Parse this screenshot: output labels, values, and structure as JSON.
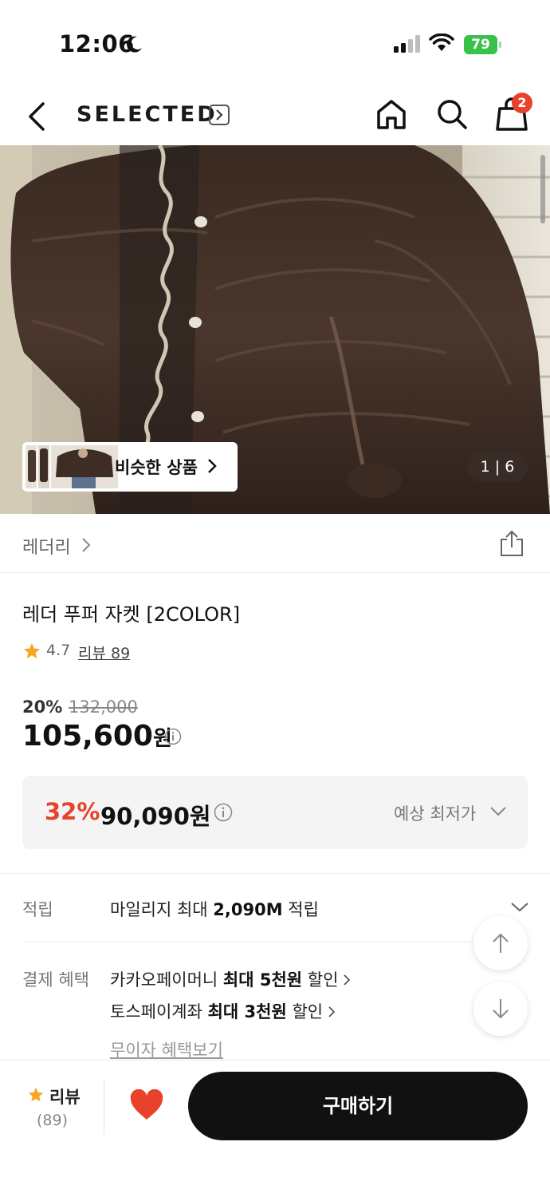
{
  "status_bar": {
    "time": "12:06",
    "battery": "79"
  },
  "header": {
    "brand": "SELECTED",
    "cart_count": "2"
  },
  "gallery": {
    "pager_current": "1",
    "pager_total": "6",
    "pager_text": "1 | 6",
    "similar_label": "비슷한 상품"
  },
  "category": {
    "label": "레더리"
  },
  "product": {
    "title": "레더 푸퍼 자켓 [2COLOR]",
    "rating": "4.7",
    "review_link": "리뷰 89",
    "discount_rate": "20%",
    "original_price": "132,000",
    "price": "105,600",
    "price_unit": "원"
  },
  "best_price": {
    "discount": "32%",
    "price": "90,090원",
    "label": "예상 최저가"
  },
  "mileage": {
    "label": "적립",
    "text_pre": "마일리지 최대 ",
    "amount": "2,090M",
    "text_post": " 적립"
  },
  "payment_benefits": {
    "label": "결제 혜택",
    "items": [
      {
        "pre": "카카오페이머니 ",
        "bold": "최대 5천원",
        "post": " 할인"
      },
      {
        "pre": "토스페이계좌 ",
        "bold": "최대 3천원",
        "post": " 할인"
      }
    ],
    "interest_free": "무이자 혜택보기"
  },
  "bottom_bar": {
    "review_label": "리뷰",
    "review_count": "(89)",
    "buy_label": "구매하기"
  },
  "colors": {
    "accent_red": "#e8412c",
    "button_black": "#111111",
    "star_yellow": "#f5a623"
  }
}
